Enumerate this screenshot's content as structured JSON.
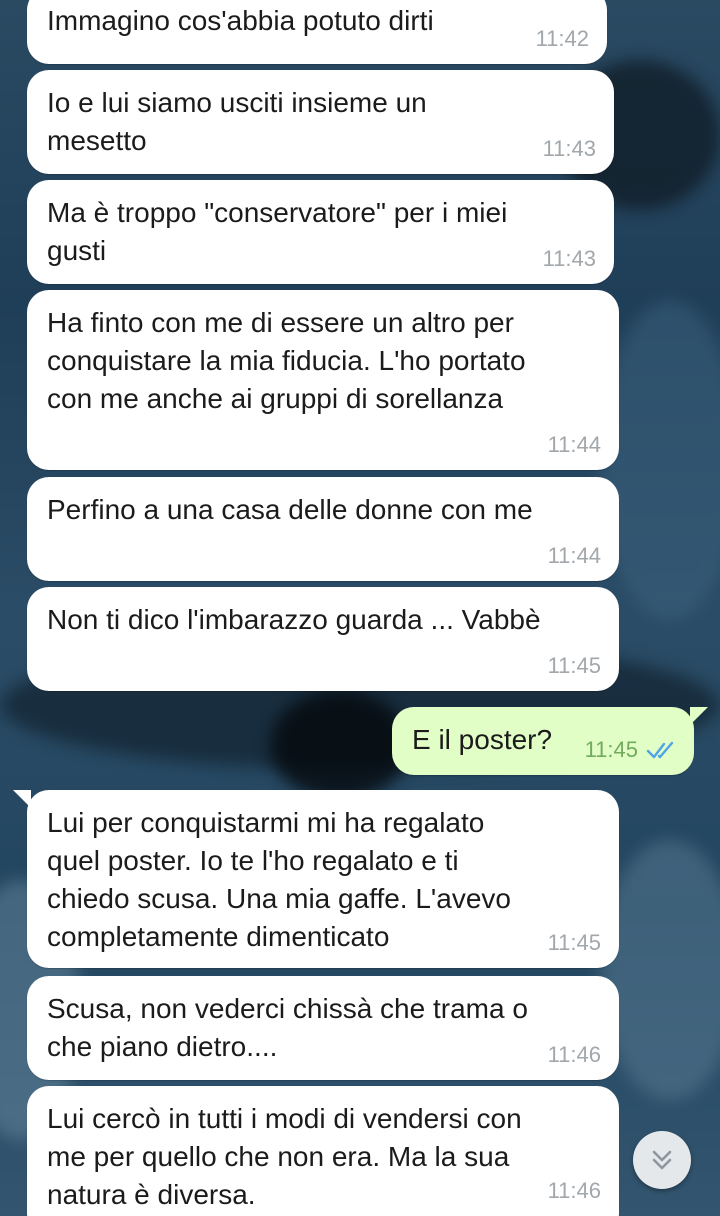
{
  "colors": {
    "incoming_bubble": "#ffffff",
    "outgoing_bubble": "#e1fec6",
    "timestamp_incoming": "#a2a7ab",
    "timestamp_outgoing": "#73ab5e",
    "read_checks": "#4fa3e8"
  },
  "messages": [
    {
      "direction": "incoming",
      "text": "Immagino cos'abbia potuto dirti",
      "time": "11:42"
    },
    {
      "direction": "incoming",
      "text": "Io e lui siamo usciti insieme un\nmesetto",
      "time": "11:43"
    },
    {
      "direction": "incoming",
      "text": "Ma è troppo \"conservatore\" per i miei\ngusti",
      "time": "11:43"
    },
    {
      "direction": "incoming",
      "text": "Ha finto con me di essere un altro per\nconquistare la mia fiducia. L'ho portato\ncon me anche ai gruppi di sorellanza",
      "time": "11:44"
    },
    {
      "direction": "incoming",
      "text": "Perfino a una casa delle donne con me",
      "time": "11:44"
    },
    {
      "direction": "incoming",
      "text": "Non ti dico l'imbarazzo guarda ... Vabbè",
      "time": "11:45"
    },
    {
      "direction": "outgoing",
      "text": "E il poster?",
      "time": "11:45",
      "status_icon": "double-check-read-icon"
    },
    {
      "direction": "incoming",
      "text": "Lui per conquistarmi mi ha regalato\nquel poster. Io te l'ho regalato e ti\nchiedo scusa. Una mia gaffe. L'avevo\ncompletamente dimenticato",
      "time": "11:45"
    },
    {
      "direction": "incoming",
      "text": "Scusa, non vederci chissà che trama o\nche piano dietro....",
      "time": "11:46"
    },
    {
      "direction": "incoming",
      "text": "Lui cercò in tutti i modi di vendersi con\nme per quello che non era. Ma la sua\nnatura è diversa.",
      "time": "11:46"
    }
  ],
  "scroll_button": {
    "icon": "chevron-double-down-icon"
  }
}
